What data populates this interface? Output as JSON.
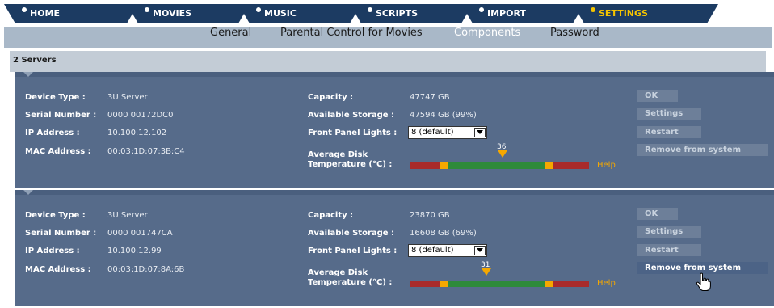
{
  "nav": {
    "tabs": [
      {
        "label": "HOME"
      },
      {
        "label": "MOVIES"
      },
      {
        "label": "MUSIC"
      },
      {
        "label": "SCRIPTS"
      },
      {
        "label": "IMPORT"
      },
      {
        "label": "SETTINGS",
        "active": true
      }
    ]
  },
  "subnav": {
    "items": [
      {
        "label": "General"
      },
      {
        "label": "Parental Control for Movies"
      },
      {
        "label": "Components",
        "active": true
      },
      {
        "label": "Password"
      }
    ]
  },
  "section": {
    "title": "2 Servers"
  },
  "labels": {
    "device_type": "Device Type :",
    "serial_number": "Serial Number :",
    "ip_address": "IP Address :",
    "mac_address": "MAC Address :",
    "capacity": "Capacity :",
    "available_storage": "Available Storage :",
    "front_panel_lights": "Front Panel Lights :",
    "avg_disk_temp_line1": "Average Disk",
    "avg_disk_temp_line2": "Temperature (°C) :",
    "help": "Help"
  },
  "buttons": {
    "ok": "OK",
    "settings": "Settings",
    "restart": "Restart",
    "remove": "Remove from system"
  },
  "servers": [
    {
      "device_type": "3U Server",
      "serial_number": "0000 00172DC0",
      "ip_address": "10.100.12.102",
      "mac_address": "00:03:1D:07:3B:C4",
      "capacity": "47747 GB",
      "available_storage": "47594 GB (99%)",
      "front_panel_lights": "8 (default)",
      "avg_disk_temp": "36",
      "temp_fraction": 0.52
    },
    {
      "device_type": "3U Server",
      "serial_number": "0000 001747CA",
      "ip_address": "10.100.12.99",
      "mac_address": "00:03:1D:07:8A:6B",
      "capacity": "23870 GB",
      "available_storage": "16608 GB (69%)",
      "front_panel_lights": "8 (default)",
      "avg_disk_temp": "31",
      "temp_fraction": 0.43
    }
  ],
  "colors": {
    "nav_bg": "#1c3b62",
    "active_tab": "#f5c400",
    "panel_bg": "#566b8a",
    "temp_red": "#a82b2b",
    "temp_amber": "#f5a800",
    "temp_green": "#2e8a3a"
  },
  "icons": {
    "tab_bullet": "dot-icon",
    "select_arrow": "chevron-down-icon",
    "cursor": "hand-pointer-icon",
    "temp_marker": "triangle-down-icon"
  }
}
